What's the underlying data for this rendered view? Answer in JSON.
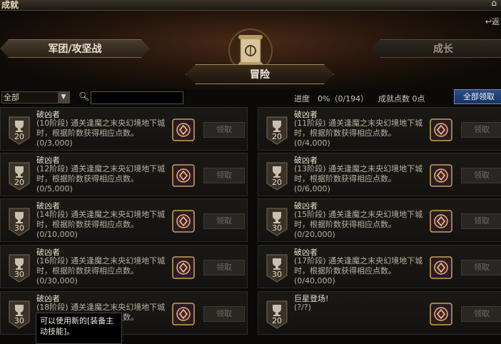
{
  "window": {
    "title": "成就",
    "back_label": "返"
  },
  "tabs": {
    "left": "军团/攻坚战",
    "center": "冒险",
    "right": "成长"
  },
  "toolbar": {
    "filter_value": "全部",
    "search_placeholder": "",
    "progress": "进度　0%（0/194）",
    "points": "成就点数 0点",
    "claim_all": "全部领取"
  },
  "cards": [
    {
      "name": "破凶者",
      "desc": "(10阶段) 通关逢魔之末央幻境地下城时，根据阶数获得相应点数。",
      "progress": "(0/3,000)",
      "badge": "20",
      "claim": "领取"
    },
    {
      "name": "破凶者",
      "desc": "(11阶段) 通关逢魔之末央幻境地下城时，根据阶数获得相应点数。",
      "progress": "(0/4,000)",
      "badge": "20",
      "claim": "领取"
    },
    {
      "name": "破凶者",
      "desc": "(12阶段) 通关逢魔之末央幻境地下城时，根据阶数获得相应点数。",
      "progress": "(0/5,000)",
      "badge": "20",
      "claim": "领取"
    },
    {
      "name": "破凶者",
      "desc": "(13阶段) 通关逢魔之末央幻境地下城时，根据阶数获得相应点数。",
      "progress": "(0/6,000)",
      "badge": "20",
      "claim": "领取"
    },
    {
      "name": "破凶者",
      "desc": "(14阶段) 通关逢魔之末央幻境地下城时，根据阶数获得相应点数。",
      "progress": "(0/10,000)",
      "badge": "30",
      "claim": "领取"
    },
    {
      "name": "破凶者",
      "desc": "(15阶段) 通关逢魔之末央幻境地下城时，根据阶数获得相应点数。",
      "progress": "(0/20,000)",
      "badge": "30",
      "claim": "领取"
    },
    {
      "name": "破凶者",
      "desc": "(16阶段) 通关逢魔之末央幻境地下城时，根据阶数获得相应点数。",
      "progress": "(0/30,000)",
      "badge": "30",
      "claim": "领取"
    },
    {
      "name": "破凶者",
      "desc": "(17阶段) 通关逢魔之末央幻境地下城时，根据阶数获得相应点数。",
      "progress": "(0/40,000)",
      "badge": "30",
      "claim": "领取"
    },
    {
      "name": "破凶者",
      "desc": "(18阶段) 通关逢魔之末央幻境地下城时，根据阶数获得相应点数。",
      "progress": "",
      "badge": "30",
      "claim": "领取"
    },
    {
      "name": "巨星登场!",
      "desc": "(?/?)",
      "progress": "",
      "badge": "20",
      "claim": "领取"
    }
  ],
  "tooltip": {
    "text": "可以使用新的[装备主动技能]。"
  },
  "colors": {
    "accent_blue": "#1f3f74",
    "gold": "#c9a25a",
    "reward_purple": "#3a2340"
  }
}
